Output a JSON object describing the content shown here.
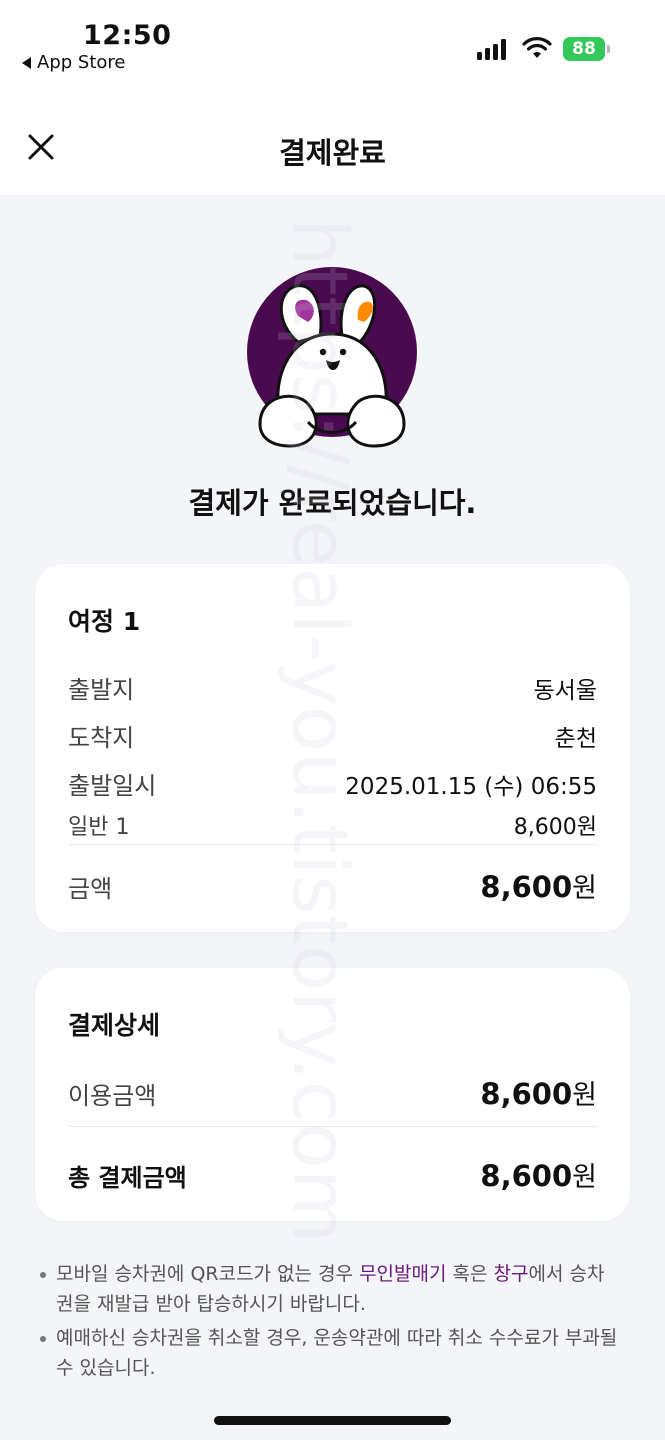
{
  "status_bar": {
    "time": "12:50",
    "back_app": "App Store",
    "battery": "88"
  },
  "navbar": {
    "title": "결제완료"
  },
  "hero": {
    "message": "결제가 완료되었습니다."
  },
  "journey_card": {
    "title": "여정 1",
    "rows": [
      {
        "label": "출발지",
        "value": "동서울"
      },
      {
        "label": "도착지",
        "value": "춘천"
      },
      {
        "label": "출발일시",
        "value": "2025.01.15 (수) 06:55"
      },
      {
        "label": "일반 1",
        "value": "8,600원"
      }
    ],
    "amount_label": "금액",
    "amount_value": "8,600",
    "amount_unit": "원"
  },
  "payment_card": {
    "title": "결제상세",
    "usage_label": "이용금액",
    "usage_value": "8,600",
    "usage_unit": "원",
    "total_label": "총 결제금액",
    "total_value": "8,600",
    "total_unit": "원"
  },
  "notes": {
    "n1_a": "모바일 승차권에 QR코드가 없는 경우 ",
    "n1_hl1": "무인발매기",
    "n1_b": " 혹은 ",
    "n1_hl2": "창구",
    "n1_c": "에서 승차권을 재발급 받아 탑승하시기 바랍니다.",
    "n2": "예매하신 승차권을 취소할 경우, 운송약관에 따라 취소 수수료가 부과될 수 있습니다."
  },
  "watermark": "https://real-you.tistory.com",
  "colors": {
    "accent": "#6a1b7a",
    "mascot_circle": "#4a0a4f",
    "ear_left": "#a0359e",
    "ear_right": "#ff8a00",
    "battery": "#34c759",
    "background": "#f4f5f9"
  }
}
